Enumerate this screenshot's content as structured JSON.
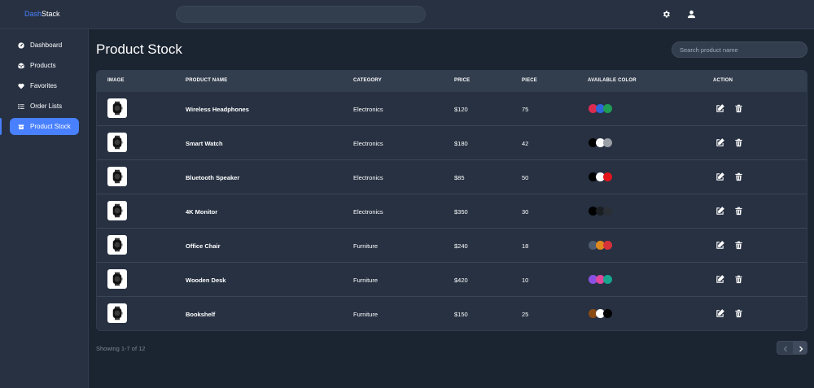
{
  "app": {
    "logo_accent": "Dash",
    "logo_rest": "Stack"
  },
  "sidebar": {
    "items": [
      {
        "label": "Dashboard",
        "icon": "dashboard-gauge-icon",
        "active": false
      },
      {
        "label": "Products",
        "icon": "cube-icon",
        "active": false
      },
      {
        "label": "Favorites",
        "icon": "heart-icon",
        "active": false
      },
      {
        "label": "Order Lists",
        "icon": "list-icon",
        "active": false
      },
      {
        "label": "Product Stock",
        "icon": "stock-box-icon",
        "active": true
      }
    ]
  },
  "main": {
    "title": "Product Stock",
    "search_placeholder": "Search product name"
  },
  "table": {
    "headers": {
      "image": "IMAGE",
      "name": "PRODUCT NAME",
      "category": "CATEGORY",
      "price": "PRICE",
      "piece": "PIECE",
      "colors": "AVAILABLE COLOR",
      "action": "ACTION"
    },
    "rows": [
      {
        "name": "Wireless Headphones",
        "category": "Electronics",
        "price": "$120",
        "piece": "75",
        "colors": [
          "#dc2b50",
          "#2f66d9",
          "#1f9d55"
        ]
      },
      {
        "name": "Smart Watch",
        "category": "Electronics",
        "price": "$180",
        "piece": "42",
        "colors": [
          "#000000",
          "#ffffff",
          "#9aa0a6"
        ]
      },
      {
        "name": "Bluetooth Speaker",
        "category": "Electronics",
        "price": "$85",
        "piece": "50",
        "colors": [
          "#000000",
          "#ffffff",
          "#e3141b"
        ]
      },
      {
        "name": "4K Monitor",
        "category": "Electronics",
        "price": "$350",
        "piece": "30",
        "colors": [
          "#000000",
          "#1b1f24",
          "#2a2f36"
        ]
      },
      {
        "name": "Office Chair",
        "category": "Furniture",
        "price": "$240",
        "piece": "18",
        "colors": [
          "#4f5b6e",
          "#e08a1e",
          "#d6323a"
        ]
      },
      {
        "name": "Wooden Desk",
        "category": "Furniture",
        "price": "$420",
        "piece": "10",
        "colors": [
          "#8b50e3",
          "#e0479b",
          "#17a58e"
        ]
      },
      {
        "name": "Bookshelf",
        "category": "Furniture",
        "price": "$150",
        "piece": "25",
        "colors": [
          "#8a4b14",
          "#ffffff",
          "#000000"
        ]
      }
    ]
  },
  "footer": {
    "showing": "Showing 1-7 of 12"
  },
  "colors": {
    "accent": "#4880ff",
    "background": "#1b2431",
    "panel": "#273142"
  }
}
